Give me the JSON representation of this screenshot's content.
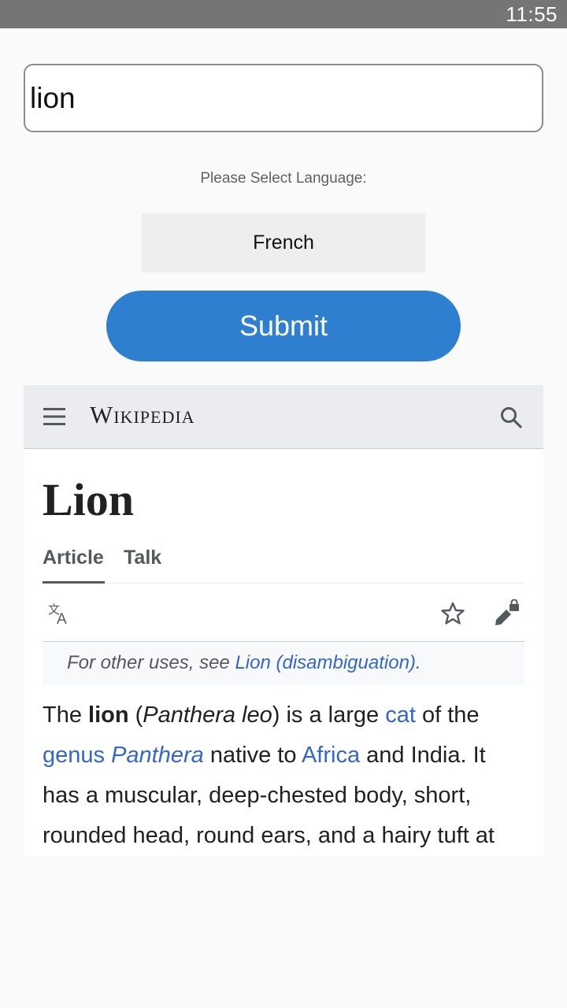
{
  "status_bar": {
    "time": "11:55"
  },
  "form": {
    "search_value": "lion",
    "language_label": "Please Select Language:",
    "language_selected": "French",
    "submit_label": "Submit"
  },
  "wiki": {
    "logo": "Wikipedia",
    "title": "Lion",
    "tabs": {
      "article": "Article",
      "talk": "Talk"
    },
    "hatnote": {
      "prefix": "For other uses, see ",
      "link": "Lion (disambiguation)",
      "suffix": "."
    },
    "paragraph": {
      "l1_a": "The ",
      "l1_b": "lion",
      "l1_c": " (",
      "l1_d": "Panthera leo",
      "l1_e": ") is a large ",
      "l1_f": "cat",
      "l1_g": " of the",
      "l2_a": "genus ",
      "l2_b": "Panthera",
      "l2_c": " native to ",
      "l2_d": "Africa",
      "l2_e": " and India. It",
      "l3": "has a muscular, deep-chested body, short,",
      "l4": "rounded head, round ears, and a hairy tuft at"
    }
  },
  "colors": {
    "accent": "#2f7fd0",
    "link": "#3366cc",
    "status_bar": "#757575"
  },
  "icons": [
    "menu-icon",
    "search-icon",
    "translate-icon",
    "star-icon",
    "edit-lock-icon"
  ]
}
